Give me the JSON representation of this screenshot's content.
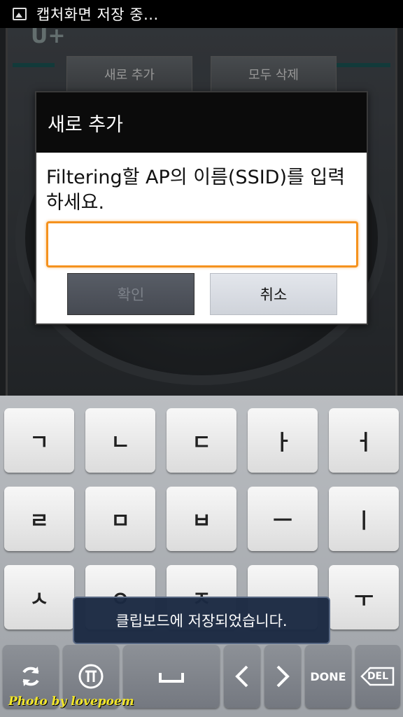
{
  "status_bar": {
    "notification_text": "캡처화면 저장 중..."
  },
  "background_app": {
    "logo": "U+",
    "add_button": "새로 추가",
    "delete_all_button": "모두 삭제"
  },
  "dialog": {
    "title": "새로 추가",
    "message": "Filtering할 AP의 이름(SSID)를 입력하세요.",
    "input_value": "",
    "ok_label": "확인",
    "cancel_label": "취소"
  },
  "keyboard": {
    "row1": [
      "ㄱ",
      "ㄴ",
      "ㄷ",
      "ㅏ",
      "ㅓ"
    ],
    "row2": [
      "ㄹ",
      "ㅁ",
      "ㅂ",
      "ㅡ",
      "ㅣ"
    ],
    "row3": [
      "ㅅ",
      "ㅇ",
      "ㅈ",
      "",
      "ㅜ"
    ],
    "bottom": {
      "done": "DONE",
      "delete": "DEL"
    },
    "accent": "#f5921e"
  },
  "toast": {
    "text": "클립보드에 저장되었습니다."
  },
  "watermark": "Photo by lovepoem"
}
